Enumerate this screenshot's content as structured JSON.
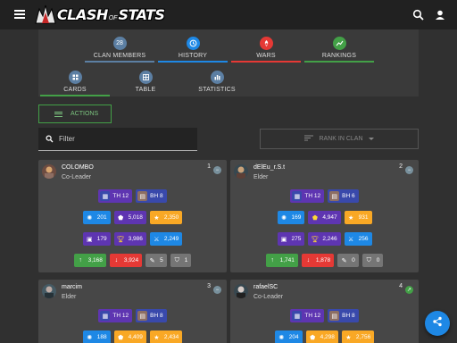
{
  "app": {
    "logo_clash": "CLASH",
    "logo_of": "OF",
    "logo_stats": "STATS"
  },
  "nav": {
    "row1": [
      {
        "label": "CLAN MEMBERS",
        "icon": "count-badge",
        "badge": "28",
        "color": "#5c7fa3",
        "underline": "#5c7fa3"
      },
      {
        "label": "HISTORY",
        "icon": "history-icon",
        "color": "#1e88e5",
        "underline": "#1e88e5"
      },
      {
        "label": "WARS",
        "icon": "war-icon",
        "color": "#e53935",
        "underline": "#e53935"
      },
      {
        "label": "RANKINGS",
        "icon": "chart-icon",
        "color": "#43a047",
        "underline": "#43a047"
      }
    ],
    "row2": [
      {
        "label": "CARDS",
        "icon": "cards-icon",
        "color": "#5c7fa3",
        "underline": "#43a047"
      },
      {
        "label": "TABLE",
        "icon": "table-icon",
        "color": "#5c7fa3",
        "underline": ""
      },
      {
        "label": "STATISTICS",
        "icon": "statistics-icon",
        "color": "#5c7fa3",
        "underline": ""
      }
    ]
  },
  "actions_label": "ACTIONS",
  "filter_placeholder": "Filter",
  "sort_label": "RANK IN CLAN",
  "members": [
    {
      "name": "COLOMBO",
      "role": "Co-Leader",
      "rank": "1",
      "trend": "neutral",
      "th": "TH 12",
      "bh": "BH 8",
      "xp": "201",
      "trophies": "5,018",
      "stars": "2,350",
      "heroes": "179",
      "builder_trophies": "3,986",
      "attacks": "2,249",
      "donated": "3,168",
      "received": "3,924",
      "clan_games": "5",
      "defense": "1"
    },
    {
      "name": "dElEu_r.S.t",
      "role": "Elder",
      "rank": "2",
      "trend": "neutral",
      "th": "TH 12",
      "bh": "BH 6",
      "xp": "169",
      "trophies": "4,947",
      "stars": "931",
      "heroes": "275",
      "builder_trophies": "2,246",
      "attacks": "256",
      "donated": "1,741",
      "received": "1,878",
      "clan_games": "0",
      "defense": "0"
    },
    {
      "name": "marcim",
      "role": "Elder",
      "rank": "3",
      "trend": "neutral",
      "th": "TH 12",
      "bh": "BH 8",
      "xp": "188",
      "trophies": "4,409",
      "stars": "2,434"
    },
    {
      "name": "rafaelSC",
      "role": "Co-Leader",
      "rank": "4",
      "trend": "up",
      "th": "TH 12",
      "bh": "BH 8",
      "xp": "204",
      "trophies": "4,298",
      "stars": "2,756"
    }
  ]
}
